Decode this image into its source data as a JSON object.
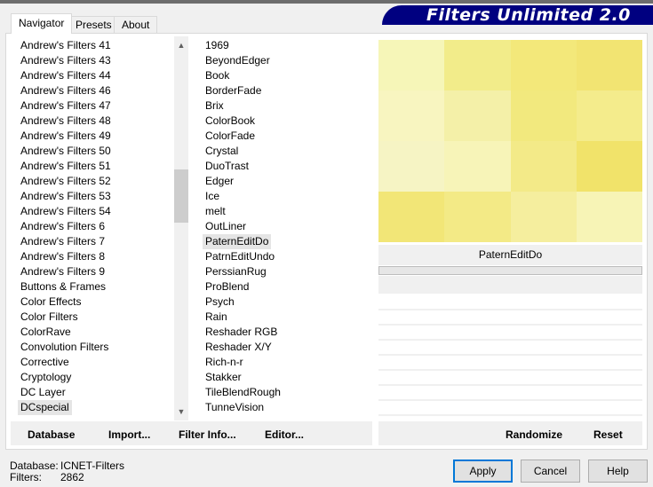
{
  "app_title": "Filters Unlimited 2.0",
  "tabs": [
    "Navigator",
    "Presets",
    "About"
  ],
  "categories": [
    "Andrew's Filters 41",
    "Andrew's Filters 43",
    "Andrew's Filters 44",
    "Andrew's Filters 46",
    "Andrew's Filters 47",
    "Andrew's Filters 48",
    "Andrew's Filters 49",
    "Andrew's Filters 50",
    "Andrew's Filters 51",
    "Andrew's Filters 52",
    "Andrew's Filters 53",
    "Andrew's Filters 54",
    "Andrew's Filters 6",
    "Andrew's Filters 7",
    "Andrew's Filters 8",
    "Andrew's Filters 9",
    "Buttons & Frames",
    "Color Effects",
    "Color Filters",
    "ColorRave",
    "Convolution Filters",
    "Corrective",
    "Cryptology",
    "DC Layer",
    "DCspecial"
  ],
  "selected_category": "DCspecial",
  "filters": [
    "1969",
    "BeyondEdger",
    "Book",
    "BorderFade",
    "Brix",
    "ColorBook",
    "ColorFade",
    "Crystal",
    "DuoTrast",
    "Edger",
    "Ice",
    "melt",
    "OutLiner",
    "PaternEditDo",
    "PatrnEditUndo",
    "PerssianRug",
    "ProBlend",
    "Psych",
    "Rain",
    "Reshader RGB",
    "Reshader X/Y",
    "Rich-n-r",
    "Stakker",
    "TileBlendRough",
    "TunneVision"
  ],
  "selected_filter": "PaternEditDo",
  "preview_label": "PaternEditDo",
  "preview_colors": [
    "#f6f6b8",
    "#f2ec8a",
    "#f3e87a",
    "#f2e472",
    "#f8f5c0",
    "#f4f0a8",
    "#f2e97e",
    "#f4ec8c",
    "#f6f4c4",
    "#f7f4b8",
    "#f3ea88",
    "#f1e36a",
    "#f2e677",
    "#f3ea86",
    "#f5ee9e",
    "#f7f4b6"
  ],
  "left_buttons": [
    "Database",
    "Import...",
    "Filter Info...",
    "Editor..."
  ],
  "right_buttons": [
    "Randomize",
    "Reset"
  ],
  "status": {
    "database_label": "Database:",
    "database_value": "ICNET-Filters",
    "filters_label": "Filters:",
    "filters_value": "2862"
  },
  "dialog_buttons": {
    "apply": "Apply",
    "cancel": "Cancel",
    "help": "Help"
  }
}
